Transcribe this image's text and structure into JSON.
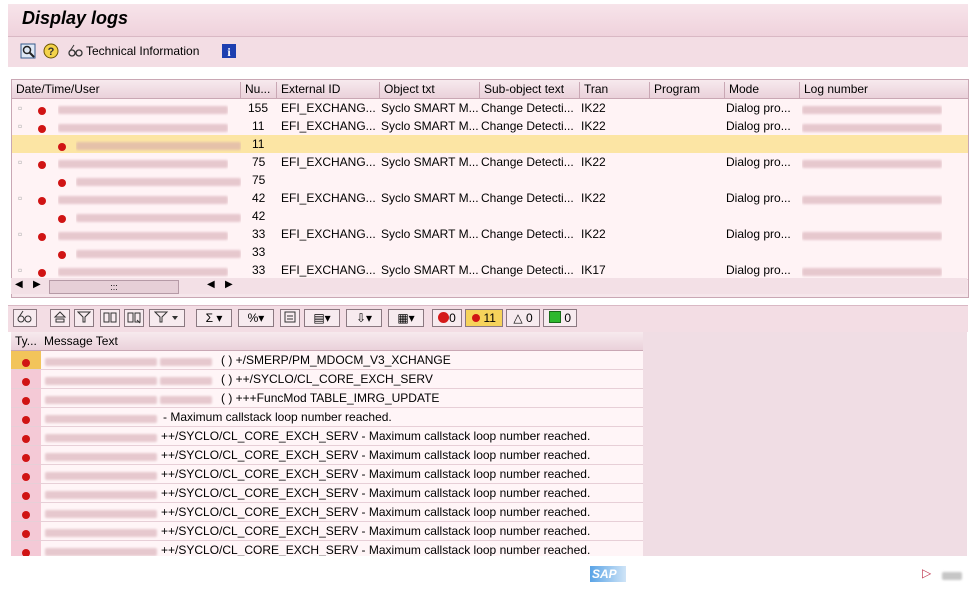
{
  "window": {
    "title": "Display logs"
  },
  "toolbar": {
    "tech_info_label": "Technical Information"
  },
  "upper_table": {
    "columns": [
      "Date/Time/User",
      "Nu...",
      "External ID",
      "Object txt",
      "Sub-object text",
      "Tran",
      "Program",
      "Mode",
      "Log number"
    ],
    "rows": [
      {
        "num": "155",
        "ext": "EFI_EXCHANG...",
        "obj": "Syclo SMART M...",
        "sub": "Change Detecti...",
        "tran": "IK22",
        "mode": "Dialog pro..."
      },
      {
        "num": "11",
        "ext": "EFI_EXCHANG...",
        "obj": "Syclo SMART M...",
        "sub": "Change Detecti...",
        "tran": "IK22",
        "mode": "Dialog pro..."
      },
      {
        "num": "11"
      },
      {
        "num": "75",
        "ext": "EFI_EXCHANG...",
        "obj": "Syclo SMART M...",
        "sub": "Change Detecti...",
        "tran": "IK22",
        "mode": "Dialog pro..."
      },
      {
        "num": "75"
      },
      {
        "num": "42",
        "ext": "EFI_EXCHANG...",
        "obj": "Syclo SMART M...",
        "sub": "Change Detecti...",
        "tran": "IK22",
        "mode": "Dialog pro..."
      },
      {
        "num": "42"
      },
      {
        "num": "33",
        "ext": "EFI_EXCHANG...",
        "obj": "Syclo SMART M...",
        "sub": "Change Detecti...",
        "tran": "IK22",
        "mode": "Dialog pro..."
      },
      {
        "num": "33"
      },
      {
        "num": "33",
        "ext": "EFI_EXCHANG...",
        "obj": "Syclo SMART M...",
        "sub": "Change Detecti...",
        "tran": "IK17",
        "mode": "Dialog pro..."
      }
    ]
  },
  "scroll": {
    "thumb_label": ":::"
  },
  "lower_toolbar": {
    "stop_count": "0",
    "error_count": "11",
    "warning_count": "0",
    "info_count": "0"
  },
  "messages": {
    "columns": [
      "Ty...",
      "Message Text"
    ],
    "rows": [
      "( ) +/SMERP/PM_MDOCM_V3_XCHANGE",
      "( ) ++/SYCLO/CL_CORE_EXCH_SERV",
      "( ) +++FuncMod TABLE_IMRG_UPDATE",
      "- Maximum callstack loop number reached.",
      "++/SYCLO/CL_CORE_EXCH_SERV - Maximum callstack loop number reached.",
      "++/SYCLO/CL_CORE_EXCH_SERV - Maximum callstack loop number reached.",
      "++/SYCLO/CL_CORE_EXCH_SERV - Maximum callstack loop number reached.",
      "++/SYCLO/CL_CORE_EXCH_SERV - Maximum callstack loop number reached.",
      "++/SYCLO/CL_CORE_EXCH_SERV - Maximum callstack loop number reached.",
      "++/SYCLO/CL_CORE_EXCH_SERV - Maximum callstack loop number reached.",
      "++/SYCLO/CL_CORE_EXCH_SERV - Maximum callstack loop number reached."
    ]
  },
  "footer": {
    "logo": "SAP"
  }
}
